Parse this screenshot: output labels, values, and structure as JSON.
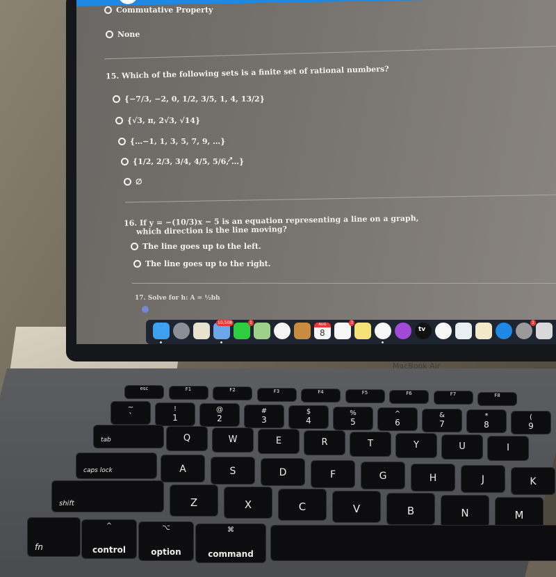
{
  "quiz": {
    "q14_tail": {
      "options": [
        "Commutative Property",
        "None"
      ]
    },
    "q15": {
      "title": "15. Which of the following sets is a finite set of rational numbers?",
      "options": [
        "{−7/3, −2, 0, 1/2, 3/5, 1, 4, 13/2}",
        "{√3, π, 2√3, √14}",
        "{…−1, 1, 3, 5, 7, 9, …}",
        "{1/2, 2/3, 3/4, 4/5, 5/6, …}",
        "∅"
      ]
    },
    "q16": {
      "title_line1": "16. If y = −(10/3)x − 5 is an equation representing a line on a graph,",
      "title_line2": "which direction is the line moving?",
      "options": [
        "The line goes up to the left.",
        "The line goes up to the right."
      ]
    },
    "q17": {
      "title_partial": "17. Solve for h: A = ½bh"
    }
  },
  "dock": {
    "items": [
      {
        "name": "Finder",
        "color": "#3ea0f0"
      },
      {
        "name": "Launchpad",
        "color": "#8b8f96"
      },
      {
        "name": "Preview-app",
        "color": "#e8e2cf"
      },
      {
        "name": "Mail",
        "color": "#6aa8e8",
        "badge": "10,508"
      },
      {
        "name": "FaceTime",
        "color": "#2ecc40",
        "badge": "1"
      },
      {
        "name": "Maps",
        "color": "#9fd08a"
      },
      {
        "name": "Photos",
        "color": "#f5f5f5"
      },
      {
        "name": "Contacts",
        "color": "#c98b3e"
      },
      {
        "name": "Calendar",
        "color": "#f7f7f7",
        "month": "AUG",
        "day": "8"
      },
      {
        "name": "Reminders",
        "color": "#f7f7f7",
        "badge": "3"
      },
      {
        "name": "Notes",
        "color": "#f7e27a"
      },
      {
        "name": "Music",
        "color": "#f7f7f7"
      },
      {
        "name": "Podcasts",
        "color": "#a24ad8"
      },
      {
        "name": "TV",
        "color": "#111111",
        "label": "tv"
      },
      {
        "name": "News",
        "color": "#f7f7f7"
      },
      {
        "name": "Keynote",
        "color": "#e8eef2"
      },
      {
        "name": "Pages",
        "color": "#f3e8c8"
      },
      {
        "name": "App Store",
        "color": "#1e88e5"
      },
      {
        "name": "System Preferences",
        "color": "#9a9a9a",
        "badge": "1"
      },
      {
        "name": "Roblox",
        "color": "#d9d9d9"
      }
    ]
  },
  "laptop": {
    "brand": "MacBook Air"
  },
  "keyboard": {
    "fn_row": [
      "esc",
      "F1",
      "F2",
      "F3",
      "F4",
      "F5",
      "F6",
      "F7",
      "F8"
    ],
    "number_row": [
      {
        "top": "~",
        "bottom": "`"
      },
      {
        "top": "!",
        "bottom": "1"
      },
      {
        "top": "@",
        "bottom": "2"
      },
      {
        "top": "#",
        "bottom": "3"
      },
      {
        "top": "$",
        "bottom": "4"
      },
      {
        "top": "%",
        "bottom": "5"
      },
      {
        "top": "^",
        "bottom": "6"
      },
      {
        "top": "&",
        "bottom": "7"
      },
      {
        "top": "*",
        "bottom": "8"
      },
      {
        "top": "(",
        "bottom": "9"
      }
    ],
    "row_q": [
      "tab",
      "Q",
      "W",
      "E",
      "R",
      "T",
      "Y",
      "U",
      "I"
    ],
    "row_a": [
      "caps lock",
      "A",
      "S",
      "D",
      "F",
      "G",
      "H",
      "J",
      "K"
    ],
    "row_z": [
      "shift",
      "Z",
      "X",
      "C",
      "V",
      "B",
      "N",
      "M"
    ],
    "bottom_row": [
      {
        "label": "fn",
        "symbol": ""
      },
      {
        "label": "control",
        "symbol": "^"
      },
      {
        "label": "option",
        "symbol": "⌥"
      },
      {
        "label": "command",
        "symbol": "⌘"
      }
    ]
  }
}
